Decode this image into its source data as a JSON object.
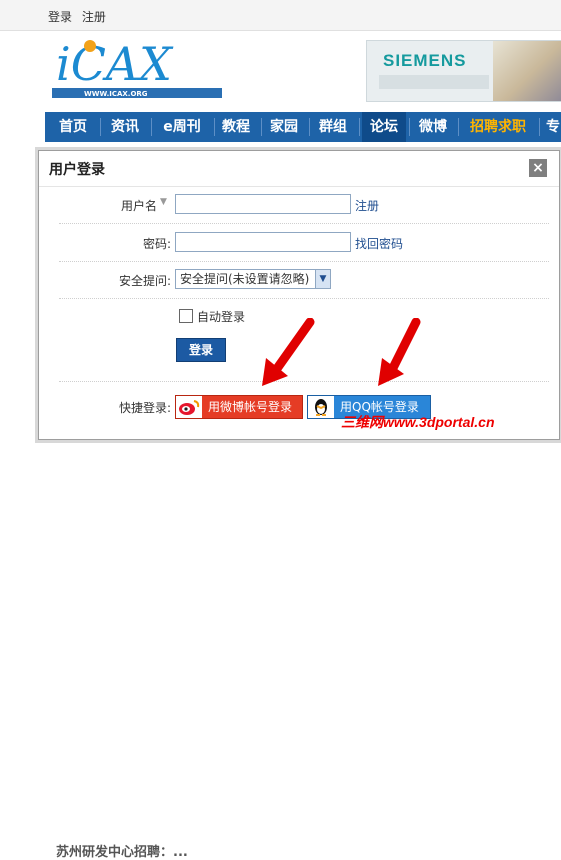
{
  "top_links": {
    "login": "登录",
    "register": "注册"
  },
  "logo": {
    "text": "iCAX",
    "url": "WWW.ICAX.ORG"
  },
  "banner": {
    "brand": "SIEMENS"
  },
  "nav": {
    "items": [
      "首页",
      "资讯",
      "e周刊",
      "教程",
      "家园",
      "群组",
      "论坛",
      "微博",
      "招聘求职",
      "专"
    ]
  },
  "dialog": {
    "title": "用户登录",
    "close": "×",
    "username_label": "用户名",
    "username_value": "",
    "register_link": "注册",
    "password_label": "密码:",
    "password_value": "",
    "forgot_link": "找回密码",
    "question_label": "安全提问:",
    "question_selected": "安全提问(未设置请忽略)",
    "autologin_label": "自动登录",
    "login_button": "登录",
    "quick_label": "快捷登录:",
    "weibo_button": "用微博帐号登录",
    "qq_button": "用QQ帐号登录"
  },
  "background": {
    "bottom_text": "苏州研发中心招聘：..."
  },
  "watermark": "三维网www.3dportal.cn",
  "colors": {
    "nav": "#1e63a8",
    "jobs": "#ffb400",
    "weibo": "#e53c25",
    "qq": "#2a86d8",
    "arrow": "#e00000"
  }
}
